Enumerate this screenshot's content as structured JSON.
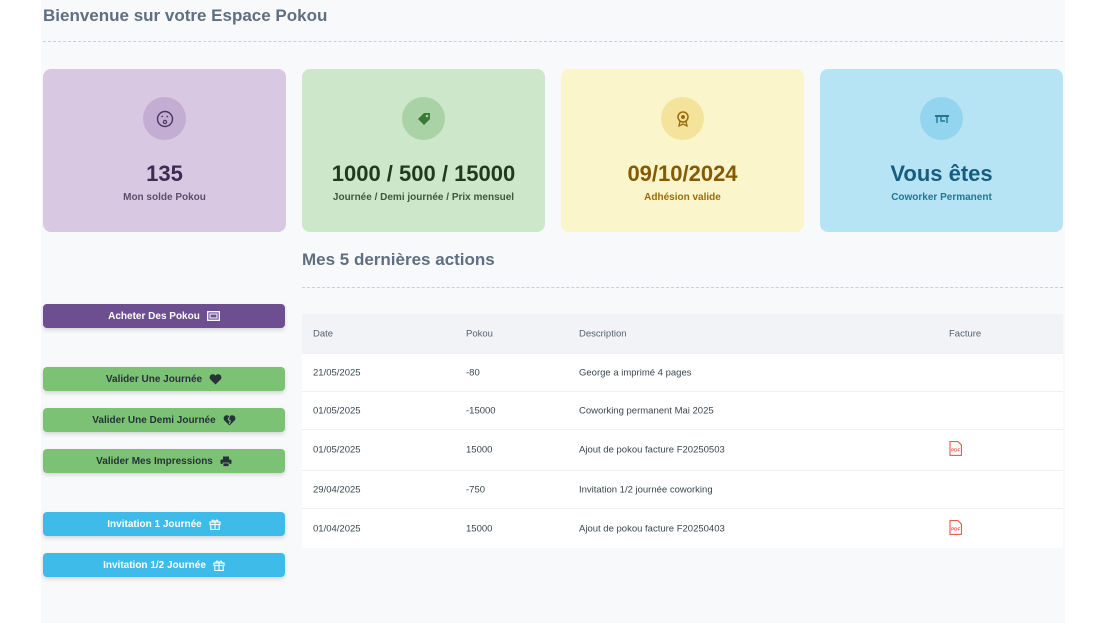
{
  "page": {
    "title": "Bienvenue sur votre Espace Pokou"
  },
  "cards": [
    {
      "value": "135",
      "label": "Mon solde Pokou",
      "icon": "face-icon",
      "bg": "#d8c8e2",
      "circle": "#c4add3",
      "value_color": "#3f2b52",
      "label_color": "#5e4d6d"
    },
    {
      "value": "1000 / 500 / 15000",
      "label": "Journée / Demi journée / Prix mensuel",
      "icon": "tag-icon",
      "bg": "#cde7cb",
      "circle": "#a9d3a6",
      "value_color": "#1f3a1d",
      "label_color": "#3b5a39"
    },
    {
      "value": "09/10/2024",
      "label": "Adhésion valide",
      "icon": "award-icon",
      "bg": "#fbf5cb",
      "circle": "#f4e39b",
      "value_color": "#855a05",
      "label_color": "#9a6d0b"
    },
    {
      "value": "Vous êtes",
      "label": "Coworker Permanent",
      "icon": "desk-icon",
      "bg": "#b7e4f5",
      "circle": "#93d4ee",
      "value_color": "#145f80",
      "label_color": "#267592"
    }
  ],
  "buttons": [
    {
      "label": "Acheter Des Pokou",
      "icon": "money-icon",
      "bg": "#6d4f91"
    },
    {
      "label": "Valider Une Journée",
      "icon": "heart-icon",
      "bg": "#7cc274"
    },
    {
      "label": "Valider Une Demi Journée",
      "icon": "broken-heart-icon",
      "bg": "#7cc274"
    },
    {
      "label": "Valider Mes Impressions",
      "icon": "printer-icon",
      "bg": "#7cc274"
    },
    {
      "label": "Invitation 1 Journée",
      "icon": "gift-icon",
      "bg": "#3ebbe8"
    },
    {
      "label": "Invitation 1/2 Journée",
      "icon": "gift-icon",
      "bg": "#3ebbe8"
    }
  ],
  "actions": {
    "title": "Mes 5 dernières actions",
    "columns": [
      "Date",
      "Pokou",
      "Description",
      "Facture"
    ],
    "rows": [
      {
        "date": "21/05/2025",
        "pokou": "-80",
        "description": "George a imprimé 4 pages",
        "facture": ""
      },
      {
        "date": "01/05/2025",
        "pokou": "-15000",
        "description": "Coworking permanent Mai 2025",
        "facture": ""
      },
      {
        "date": "01/05/2025",
        "pokou": "15000",
        "description": "Ajout de pokou facture F20250503",
        "facture": "PDF"
      },
      {
        "date": "29/04/2025",
        "pokou": "-750",
        "description": "Invitation 1/2 journée coworking",
        "facture": ""
      },
      {
        "date": "01/04/2025",
        "pokou": "15000",
        "description": "Ajout de pokou facture F20250403",
        "facture": "PDF"
      }
    ]
  }
}
